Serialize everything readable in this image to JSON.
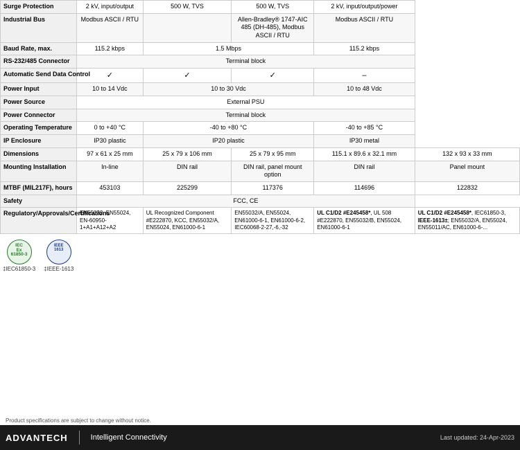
{
  "table": {
    "rows": [
      {
        "label": "Surge Protection",
        "cols": [
          "2 kV, input/output",
          "500 W, TVS",
          "500 W, TVS",
          "2 kV, input/output/power"
        ]
      },
      {
        "label": "Industrial Bus",
        "cols": [
          "Modbus ASCII / RTU",
          "",
          "Allen-Bradley® 1747-AIC 485 (DH-485), Modbus ASCII / RTU",
          "Modbus ASCII / RTU"
        ]
      },
      {
        "label": "Baud Rate, max.",
        "cols": [
          "115.2 kbps",
          "1.5 Mbps",
          "",
          "115.2 kbps"
        ]
      },
      {
        "label": "RS-232/485 Connector",
        "cols": [
          "",
          "Terminal block",
          "",
          ""
        ]
      },
      {
        "label": "Automatic Send Data Control",
        "cols": [
          "✓",
          "✓",
          "✓",
          "–"
        ]
      },
      {
        "label": "Power Input",
        "cols": [
          "10 to 14  Vdc",
          "10 to 30 Vdc",
          "",
          "10 to 48 Vdc"
        ]
      },
      {
        "label": "Power Source",
        "cols": [
          "",
          "External PSU",
          "",
          ""
        ]
      },
      {
        "label": "Power Connector",
        "cols": [
          "",
          "Terminal block",
          "",
          ""
        ]
      },
      {
        "label": "Operating Temperature",
        "cols": [
          "0 to +40 °C",
          "-40 to +80 °C",
          "",
          "-40 to +85 °C"
        ]
      },
      {
        "label": "IP Enclosure",
        "cols": [
          "IP30 plastic",
          "IP20 plastic",
          "",
          "IP30 metal"
        ]
      },
      {
        "label": "Dimensions",
        "cols": [
          "97 x 61 x 25 mm",
          "25 x 79 x 106 mm",
          "25 x 79 x 95 mm",
          "115.1 x 89.6 x 32.1 mm",
          "132 x 93 x 33 mm"
        ]
      },
      {
        "label": "Mounting Installation",
        "cols": [
          "In-line",
          "DIN rail",
          "DIN rail, panel mount option",
          "DIN rail",
          "Panel mount"
        ]
      },
      {
        "label": "MTBF (MIL217F), hours",
        "cols": [
          "453103",
          "225299",
          "117376",
          "114696",
          "122832"
        ]
      },
      {
        "label": "Safety",
        "cols": [
          "",
          "",
          "FCC, CE",
          "",
          ""
        ]
      },
      {
        "label": "Regulatory/Approvals/Certifications",
        "cols": [
          "EN55032, EN55024, EN-60950-1+A1+A12+A2",
          "UL Recognized Component #E222870, KCC, EN55032/A, EN55024, EN61000-6-1",
          "EN55032/A, EN55024, EN61000-6-1, EN61000-6-2, IEC60068-2-27,-6,-32",
          "UL C1/D2 #E245458*, UL 508 #E222870, EN55032/B, EN55024, EN61000-6-1",
          "UL C1/D2 #E245458*, IEC61850-3, IEEE-1613±; EN55032/A, EN55024, EN55011/AC, EN61000-6-..."
        ]
      }
    ]
  },
  "logos": [
    {
      "id": "iecex1",
      "line1": "IEC",
      "line2": "61850-3",
      "label": "‡IEC61850-3",
      "type": "iec"
    },
    {
      "id": "ieee1",
      "line1": "IEEE",
      "line2": "1613",
      "label": "‡IEEE-1613",
      "type": "ieee"
    }
  ],
  "footer": {
    "brand": "ADVANTECH",
    "tagline": "Intelligent Connectivity",
    "note": "Product specifications are subject to change without notice.",
    "updated": "Last updated: 24-Apr-2023"
  },
  "label_connector": "Connector"
}
